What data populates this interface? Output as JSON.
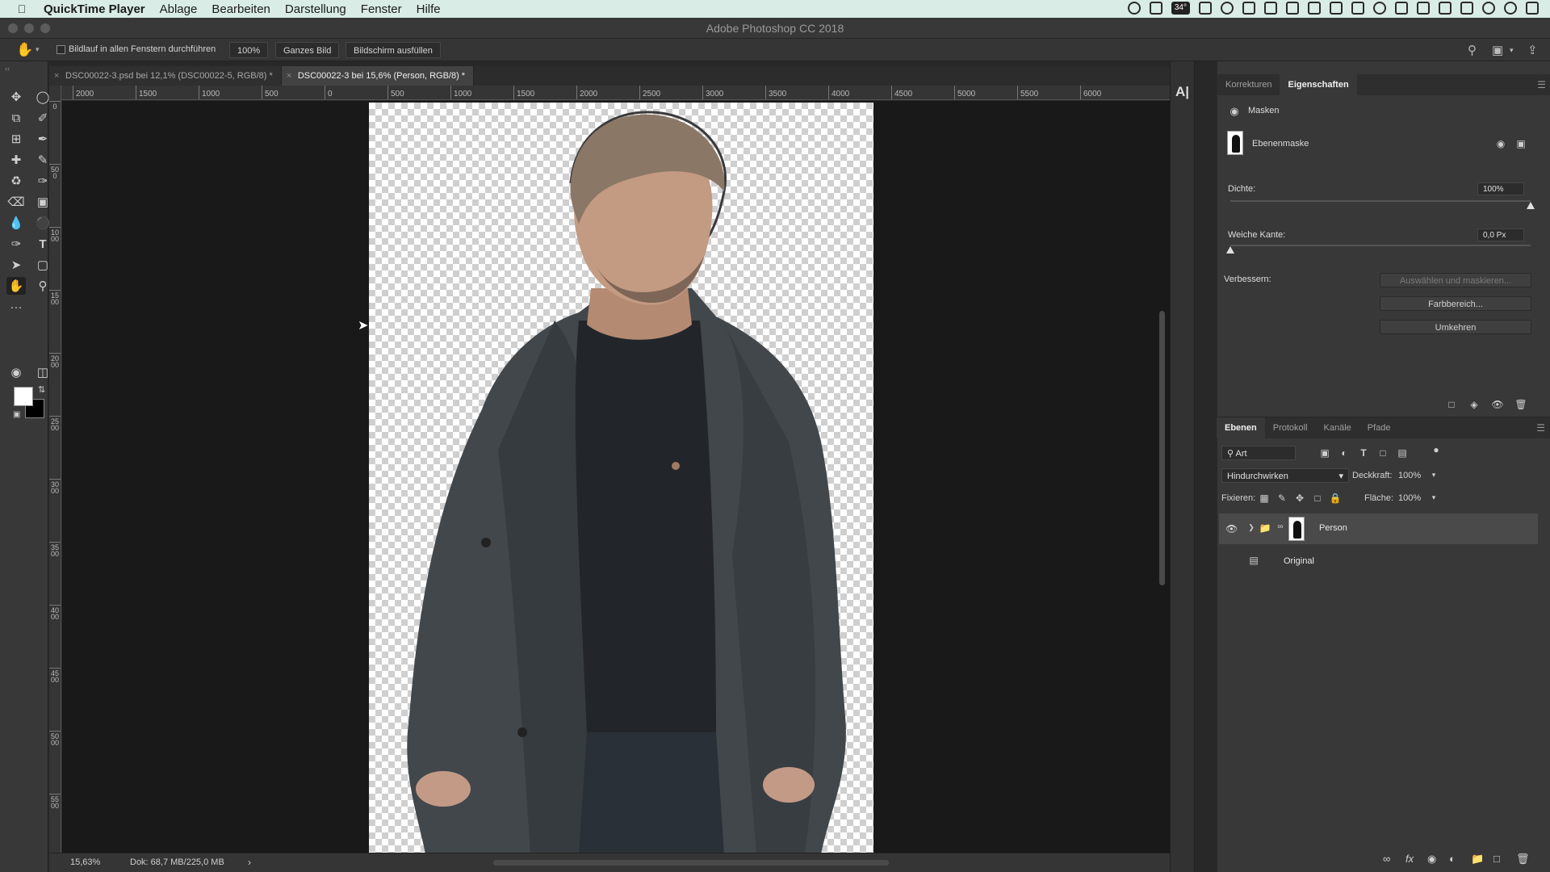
{
  "menubar": {
    "app_name": "QuickTime Player",
    "items": [
      "Ablage",
      "Bearbeiten",
      "Darstellung",
      "Fenster",
      "Hilfe"
    ],
    "temperature": "34°"
  },
  "window": {
    "title": "Adobe Photoshop CC 2018"
  },
  "options_bar": {
    "scroll_all_label": "Bildlauf in allen Fenstern durchführen",
    "zoom_100": "100%",
    "fit_screen": "Ganzes Bild",
    "fill_screen": "Bildschirm ausfüllen"
  },
  "tabs": [
    {
      "label": "DSC00022-3.psd bei 12,1% (DSC00022-5, RGB/8) *",
      "active": false
    },
    {
      "label": "DSC00022-3 bei 15,6% (Person, RGB/8) *",
      "active": true
    }
  ],
  "ruler": {
    "h_ticks": [
      "2000",
      "1500",
      "1000",
      "500",
      "0",
      "500",
      "1000",
      "1500",
      "2000",
      "2500",
      "3000",
      "3500",
      "4000",
      "4500",
      "5000",
      "5500",
      "6000"
    ],
    "v_ticks": [
      "0",
      "500",
      "1000",
      "1500",
      "2000",
      "2500",
      "3000",
      "3500",
      "4000",
      "4500",
      "5000",
      "5500"
    ]
  },
  "status": {
    "zoom": "15,63%",
    "doc_size": "Dok: 68,7 MB/225,0 MB"
  },
  "properties": {
    "tabs": [
      "Korrekturen",
      "Eigenschaften"
    ],
    "active_tab": "Eigenschaften",
    "section_title": "Masken",
    "mask_type": "Ebenenmaske",
    "density_label": "Dichte:",
    "density_value": "100%",
    "density_level": 1.0,
    "feather_label": "Weiche Kante:",
    "feather_value": "0,0 Px",
    "feather_level": 0.0,
    "refine_label": "Verbessern:",
    "select_and_mask": "Auswählen und maskieren...",
    "color_range": "Farbbereich...",
    "invert": "Umkehren"
  },
  "layers_panel": {
    "tabs": [
      "Ebenen",
      "Protokoll",
      "Kanäle",
      "Pfade"
    ],
    "active_tab": "Ebenen",
    "filter_kind": "Art",
    "blend_mode": "Hindurchwirken",
    "opacity_label": "Deckkraft:",
    "opacity_value": "100%",
    "lock_label": "Fixieren:",
    "fill_label": "Fläche:",
    "fill_value": "100%",
    "layers": [
      {
        "name": "Person",
        "visible": true,
        "selected": true,
        "kind": "group-with-mask"
      },
      {
        "name": "Original",
        "visible": false,
        "selected": false,
        "kind": "smart-object"
      }
    ]
  },
  "colors": {
    "menubar_bg": "#d9ece6",
    "canvas_bg": "#191919",
    "foreground_swatch": "#ffffff",
    "background_swatch": "#000000"
  }
}
